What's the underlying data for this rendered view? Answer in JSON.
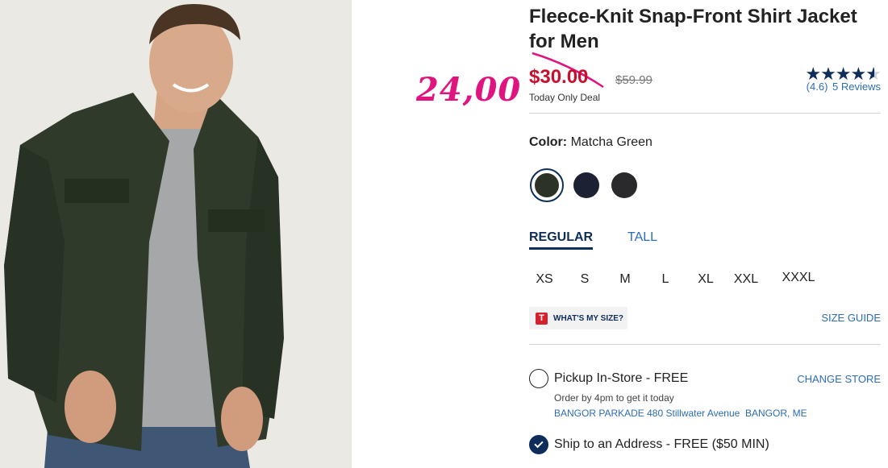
{
  "product": {
    "title": "Fleece-Knit Snap-Front Shirt Jacket for Men",
    "sale_price": "$30.00",
    "original_price": "$59.99",
    "deal_label": "Today Only Deal",
    "rating_value": "(4.6)",
    "reviews_label": "5 Reviews",
    "rating": 4.6,
    "rating_max": 5
  },
  "annotation": {
    "handwritten_price": "24,00",
    "color": "#e0147f"
  },
  "color": {
    "label": "Color:",
    "selected": "Matcha Green",
    "swatches": [
      {
        "name": "matcha-green",
        "hex": "#2d3226",
        "selected": true
      },
      {
        "name": "navy",
        "hex": "#1c2233",
        "selected": false
      },
      {
        "name": "black",
        "hex": "#2a2a2c",
        "selected": false
      }
    ]
  },
  "fit": {
    "tabs": [
      {
        "label": "REGULAR",
        "active": true
      },
      {
        "label": "TALL",
        "active": false
      }
    ]
  },
  "sizes": [
    "XS",
    "S",
    "M",
    "L",
    "XL",
    "XXL",
    "XXXL"
  ],
  "size_help": {
    "logo": "T",
    "whats_my_size": "WHAT'S MY SIZE?",
    "size_guide": "SIZE GUIDE"
  },
  "fulfillment": {
    "pickup": {
      "label": "Pickup In-Store - FREE",
      "note": "Order by 4pm to get it today",
      "store": "BANGOR PARKADE 480 Stillwater Avenue  BANGOR, ME",
      "change": "CHANGE STORE",
      "checked": false
    },
    "ship": {
      "label": "Ship to an Address - FREE ($50 MIN)",
      "checked": true
    }
  },
  "colors": {
    "brand_navy": "#0e2d5b",
    "sale_red": "#c8102e",
    "link_blue": "#2c6db5"
  }
}
